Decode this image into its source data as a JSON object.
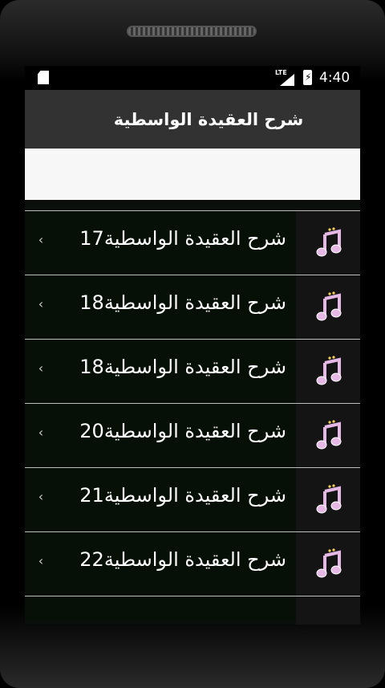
{
  "status_bar": {
    "network": "LTE",
    "time": "4:40"
  },
  "app_bar": {
    "title": "شرح العقيدة الواسطية"
  },
  "search": {
    "value": ""
  },
  "list": {
    "items": [
      {
        "label": "شرح العقيدة الواسطية17"
      },
      {
        "label": "شرح العقيدة الواسطية18"
      },
      {
        "label": "شرح العقيدة الواسطية18"
      },
      {
        "label": "شرح العقيدة الواسطية20"
      },
      {
        "label": "شرح العقيدة الواسطية21"
      },
      {
        "label": "شرح العقيدة الواسطية22"
      }
    ],
    "chevron": "‹",
    "icon": "music-note-icon"
  },
  "colors": {
    "note": "#e6b8e6",
    "appbar": "#323232",
    "row_bg": "#071007",
    "icon_cell": "#141414"
  }
}
